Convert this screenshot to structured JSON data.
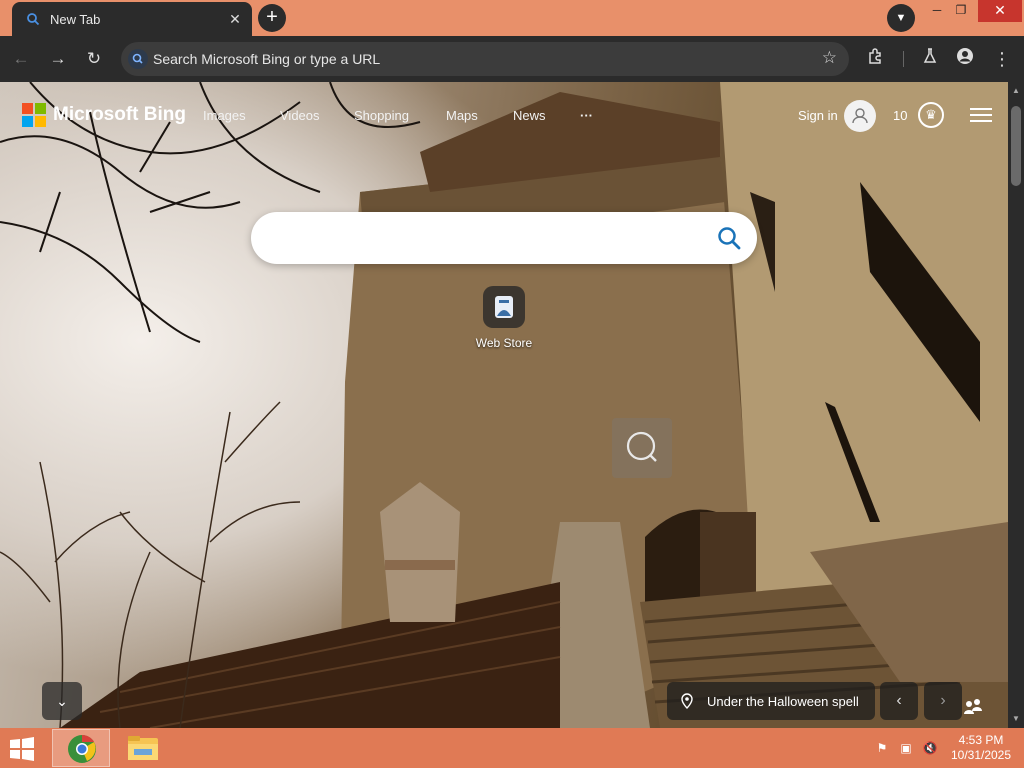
{
  "browser": {
    "tab": {
      "title": "New Tab"
    },
    "omnibox": {
      "placeholder": "Search Microsoft Bing or type a URL"
    }
  },
  "bing": {
    "logo_text": "Microsoft Bing",
    "nav": [
      "Images",
      "Videos",
      "Shopping",
      "Maps",
      "News",
      "···"
    ],
    "sign_in": "Sign in",
    "points": "10",
    "search_placeholder": "",
    "quick_link": {
      "label": "Web Store"
    },
    "image_caption": "Under the Halloween spell"
  },
  "colors": {
    "tab_bg": "#2b2b2b",
    "frame_accent": "#e8906a",
    "taskbar": "#e07a55",
    "ms_red": "#f25022",
    "ms_green": "#7fba00",
    "ms_blue": "#00a4ef",
    "ms_yellow": "#ffb900",
    "search_icon": "#1a73b8"
  },
  "icons": {
    "tab": "bing-search-icon",
    "toolbar": [
      "back-arrow-icon",
      "forward-arrow-icon",
      "reload-icon",
      "star-icon",
      "extensions-icon",
      "labs-icon",
      "profile-icon",
      "more-menu-icon"
    ],
    "page": [
      "search-icon",
      "visual-search-icon",
      "location-pin-icon",
      "chevron-left-icon",
      "chevron-right-icon",
      "chevron-down-icon",
      "feedback-icon"
    ],
    "taskbar": [
      "windows-start-icon",
      "chrome-icon",
      "file-explorer-icon",
      "action-center-flag-icon",
      "network-icon",
      "volume-muted-icon"
    ]
  },
  "taskbar": {
    "time": "4:53 PM",
    "date": "10/31/2025"
  }
}
